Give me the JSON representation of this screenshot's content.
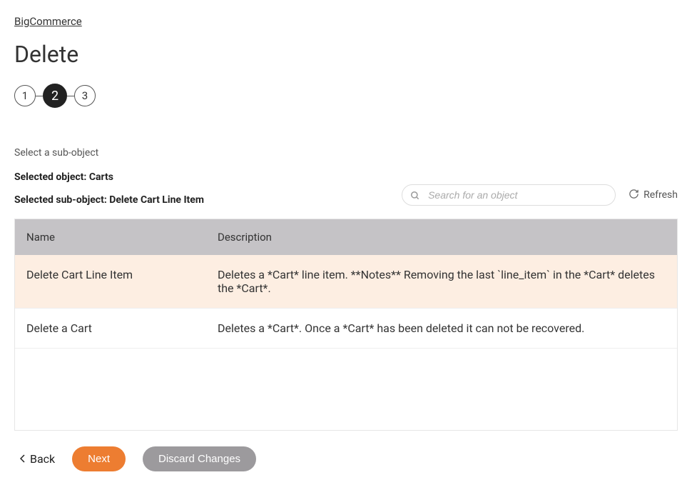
{
  "breadcrumb": "BigCommerce",
  "page_title": "Delete",
  "stepper": {
    "s1": "1",
    "s2": "2",
    "s3": "3"
  },
  "section_label": "Select a sub-object",
  "selected_object_line": "Selected object: Carts",
  "selected_sub_object_line": "Selected sub-object: Delete Cart Line Item",
  "search": {
    "placeholder": "Search for an object"
  },
  "refresh_label": "Refresh",
  "table": {
    "headers": {
      "name": "Name",
      "description": "Description"
    },
    "rows": [
      {
        "name": "Delete Cart Line Item",
        "description": "Deletes a *Cart* line item. **Notes** Removing the last `line_item` in the *Cart* deletes the *Cart*.",
        "selected": true
      },
      {
        "name": "Delete a Cart",
        "description": "Deletes a *Cart*. Once a *Cart* has been deleted it can not be recovered.",
        "selected": false
      }
    ]
  },
  "footer": {
    "back": "Back",
    "next": "Next",
    "discard": "Discard Changes"
  }
}
